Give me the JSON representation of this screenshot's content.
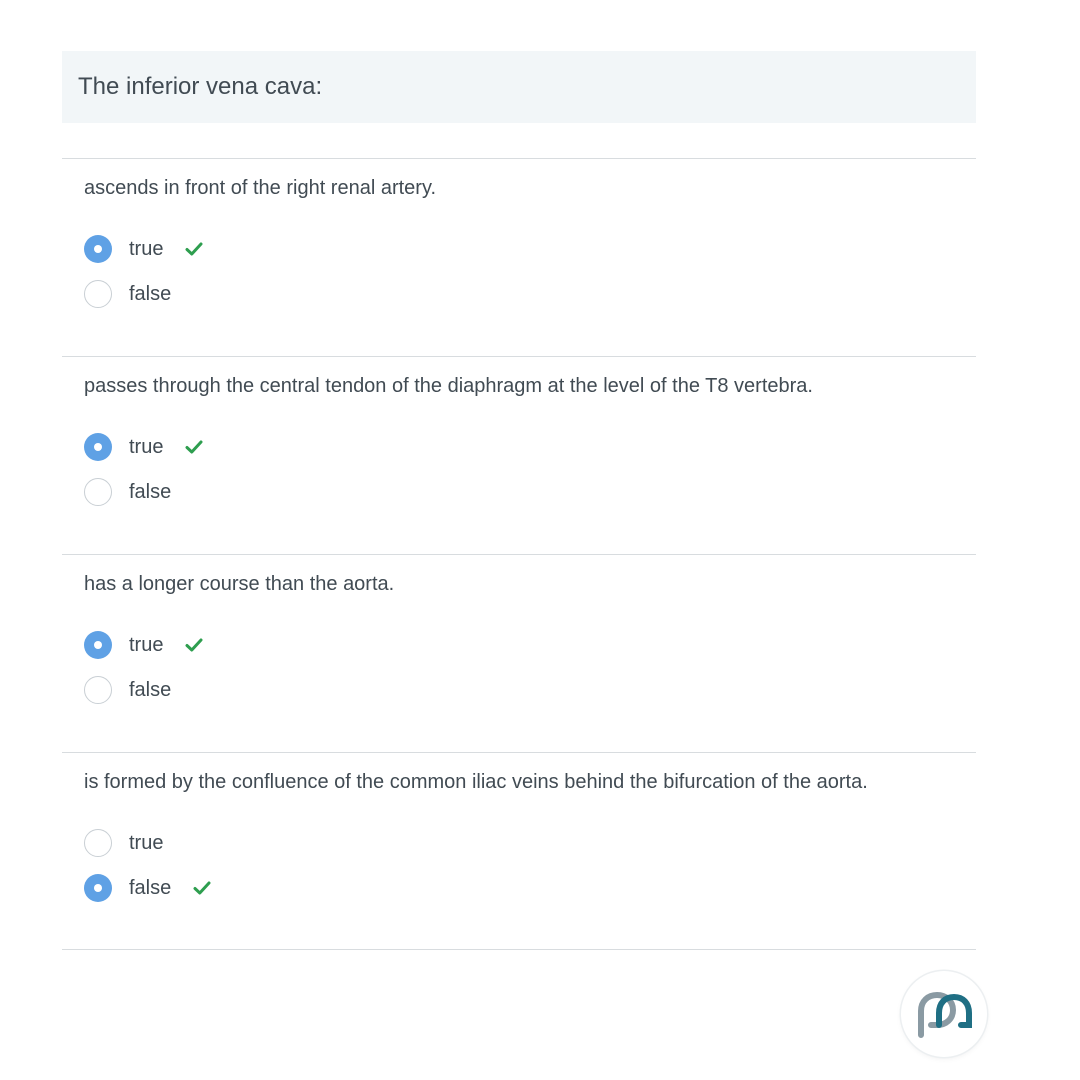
{
  "question": {
    "title": "The inferior vena cava:"
  },
  "statements": [
    {
      "text": "ascends in front of the right renal artery.",
      "options": [
        {
          "label": "true",
          "selected": true,
          "correct": true
        },
        {
          "label": "false",
          "selected": false,
          "correct": false
        }
      ]
    },
    {
      "text": "passes through the central tendon of the diaphragm at the level of the T8 vertebra.",
      "options": [
        {
          "label": "true",
          "selected": true,
          "correct": true
        },
        {
          "label": "false",
          "selected": false,
          "correct": false
        }
      ]
    },
    {
      "text": "has a longer course than the aorta.",
      "options": [
        {
          "label": "true",
          "selected": true,
          "correct": true
        },
        {
          "label": "false",
          "selected": false,
          "correct": false
        }
      ]
    },
    {
      "text": "is formed by the confluence of the common iliac veins behind the bifurcation of the aorta.",
      "options": [
        {
          "label": "true",
          "selected": false,
          "correct": false
        },
        {
          "label": "false",
          "selected": true,
          "correct": true
        }
      ]
    }
  ],
  "icons": {
    "correct_marker": "checkmark-icon",
    "logo": "brand-logo-icon"
  },
  "colors": {
    "radio_selected": "#5fa1e5",
    "check": "#2e9e4f",
    "header_bg": "#f2f6f8",
    "text": "#414b53",
    "divider": "#d8dcdf",
    "logo_gray": "#8a9aa3",
    "logo_teal": "#1f6f84"
  }
}
